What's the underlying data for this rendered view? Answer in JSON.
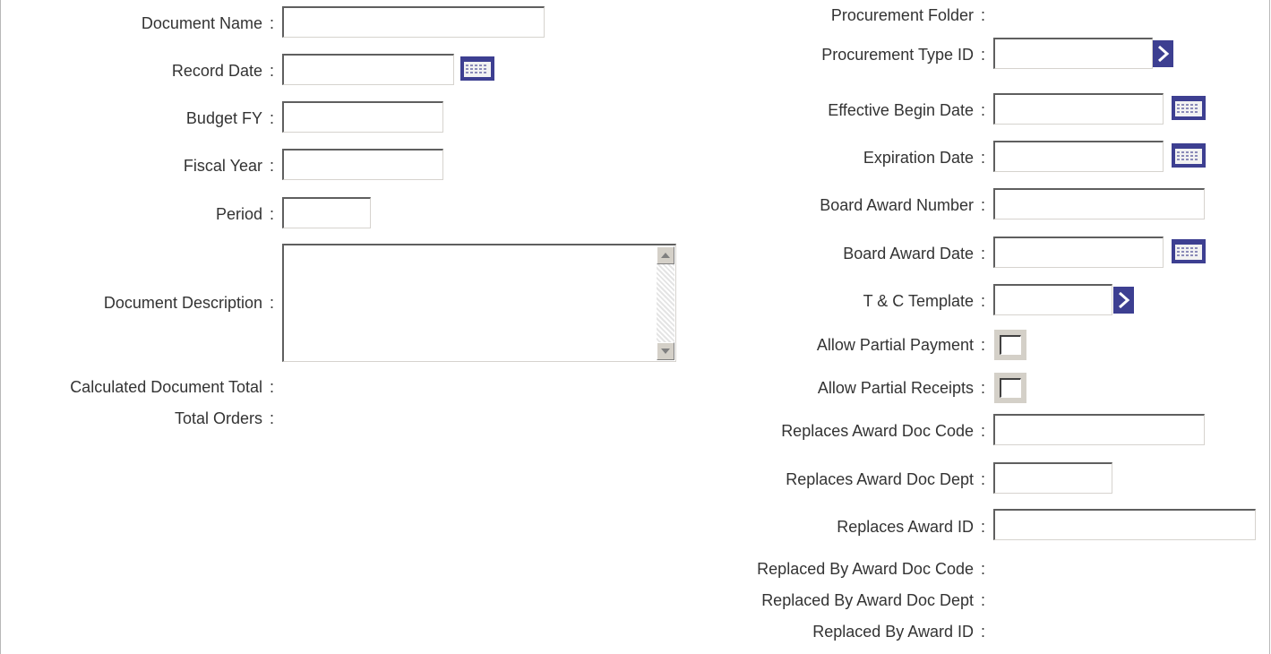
{
  "left_fields": {
    "document_name": {
      "label": "Document Name",
      "value": ""
    },
    "record_date": {
      "label": "Record Date",
      "value": ""
    },
    "budget_fy": {
      "label": "Budget FY",
      "value": ""
    },
    "fiscal_year": {
      "label": "Fiscal Year",
      "value": ""
    },
    "period": {
      "label": "Period",
      "value": ""
    },
    "document_description": {
      "label": "Document Description",
      "value": ""
    },
    "calculated_document_total": {
      "label": "Calculated Document Total",
      "value": ""
    },
    "total_orders": {
      "label": "Total Orders",
      "value": ""
    }
  },
  "right_fields": {
    "procurement_folder": {
      "label": "Procurement Folder",
      "value": ""
    },
    "procurement_type_id": {
      "label": "Procurement Type ID",
      "value": ""
    },
    "effective_begin_date": {
      "label": "Effective Begin Date",
      "value": ""
    },
    "expiration_date": {
      "label": "Expiration Date",
      "value": ""
    },
    "board_award_number": {
      "label": "Board Award Number",
      "value": ""
    },
    "board_award_date": {
      "label": "Board Award Date",
      "value": ""
    },
    "tc_template": {
      "label": "T & C Template",
      "value": ""
    },
    "allow_partial_payment": {
      "label": "Allow Partial Payment",
      "checked": false
    },
    "allow_partial_receipts": {
      "label": "Allow Partial Receipts",
      "checked": false
    },
    "replaces_award_doc_code": {
      "label": "Replaces Award Doc Code",
      "value": ""
    },
    "replaces_award_doc_dept": {
      "label": "Replaces Award Doc Dept",
      "value": ""
    },
    "replaces_award_id": {
      "label": "Replaces Award ID",
      "value": ""
    },
    "replaced_by_award_doc_code": {
      "label": "Replaced By Award Doc Code",
      "value": ""
    },
    "replaced_by_award_doc_dept": {
      "label": "Replaced By Award Doc Dept",
      "value": ""
    },
    "replaced_by_award_id": {
      "label": "Replaced By Award ID",
      "value": ""
    }
  },
  "separator": ":",
  "icons": {
    "calendar": "calendar-icon",
    "pick_list": "chevron-right-icon",
    "scroll_up": "scroll-up-arrow-icon",
    "scroll_down": "scroll-down-arrow-icon"
  },
  "colors": {
    "label_text": "#333333",
    "icon_accent": "#3d3f91",
    "field_border": "#5f5f5f",
    "checkbox_frame": "#d4d0c8"
  }
}
